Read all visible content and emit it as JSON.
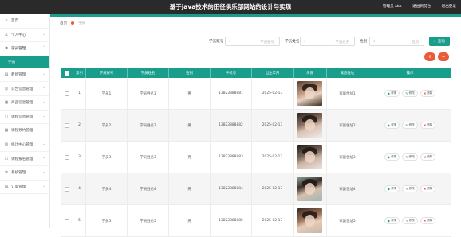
{
  "header": {
    "title": "基于java技术的田径俱乐部网站的设计与实现",
    "admin_label": "管理员 abo",
    "frontend_link": "退出到前台",
    "logout_link": "退出登录"
  },
  "sidebar": {
    "items": [
      {
        "label": "首页",
        "icon": "home-icon"
      },
      {
        "label": "个人中心",
        "icon": "user-icon"
      },
      {
        "label": "学员管理",
        "icon": "flag-icon"
      },
      {
        "label": "教师管理",
        "icon": "chart-icon"
      },
      {
        "label": "公告信息管理",
        "icon": "megaphone-icon"
      },
      {
        "label": "商品信息管理",
        "icon": "box-icon"
      },
      {
        "label": "课程信息管理",
        "icon": "book-icon"
      },
      {
        "label": "课程预约管理",
        "icon": "calendar-icon"
      },
      {
        "label": "统计中心管理",
        "icon": "stats-icon"
      },
      {
        "label": "课程报名管理",
        "icon": "clipboard-icon"
      },
      {
        "label": "系统管理",
        "icon": "gear-icon"
      },
      {
        "label": "订单管理",
        "icon": "cart-icon"
      }
    ],
    "active_sub": "学员"
  },
  "breadcrumb": {
    "home": "首页",
    "current": "学员"
  },
  "search": {
    "fields": [
      {
        "label": "学员账号",
        "placeholder": "学员账号"
      },
      {
        "label": "学员姓名",
        "placeholder": "学员姓名"
      },
      {
        "label": "性别",
        "placeholder": "性别"
      }
    ],
    "button_label": "查询"
  },
  "actions": {
    "add_symbol": "+",
    "delete_symbol": "−"
  },
  "table": {
    "columns": [
      "",
      "索引",
      "学员账号",
      "学员姓名",
      "性别",
      "手机号",
      "出生年月",
      "头像",
      "家庭住址",
      "操作"
    ],
    "rows": [
      {
        "index": "1",
        "account": "学员1",
        "name": "学员姓名1",
        "gender": "男",
        "phone": "13823888881",
        "birth": "2025-02-13",
        "address": "家庭住址1"
      },
      {
        "index": "2",
        "account": "学员2",
        "name": "学员姓名2",
        "gender": "男",
        "phone": "13823888882",
        "birth": "2025-02-13",
        "address": "家庭住址2"
      },
      {
        "index": "3",
        "account": "学员3",
        "name": "学员姓名3",
        "gender": "男",
        "phone": "13823888883",
        "birth": "2025-02-13",
        "address": "家庭住址3"
      },
      {
        "index": "4",
        "account": "学员4",
        "name": "学员姓名4",
        "gender": "男",
        "phone": "13823888884",
        "birth": "2025-02-13",
        "address": "家庭住址4"
      },
      {
        "index": "5",
        "account": "学员5",
        "name": "学员姓名5",
        "gender": "男",
        "phone": "13823888885",
        "birth": "2025-02-13",
        "address": "家庭住址5"
      }
    ],
    "op_view": "详情",
    "op_edit": "修改",
    "op_delete": "删除"
  },
  "colors": {
    "accent": "#1a9e8c",
    "danger": "#ea5b3a",
    "topbar": "#2a2a2a"
  }
}
